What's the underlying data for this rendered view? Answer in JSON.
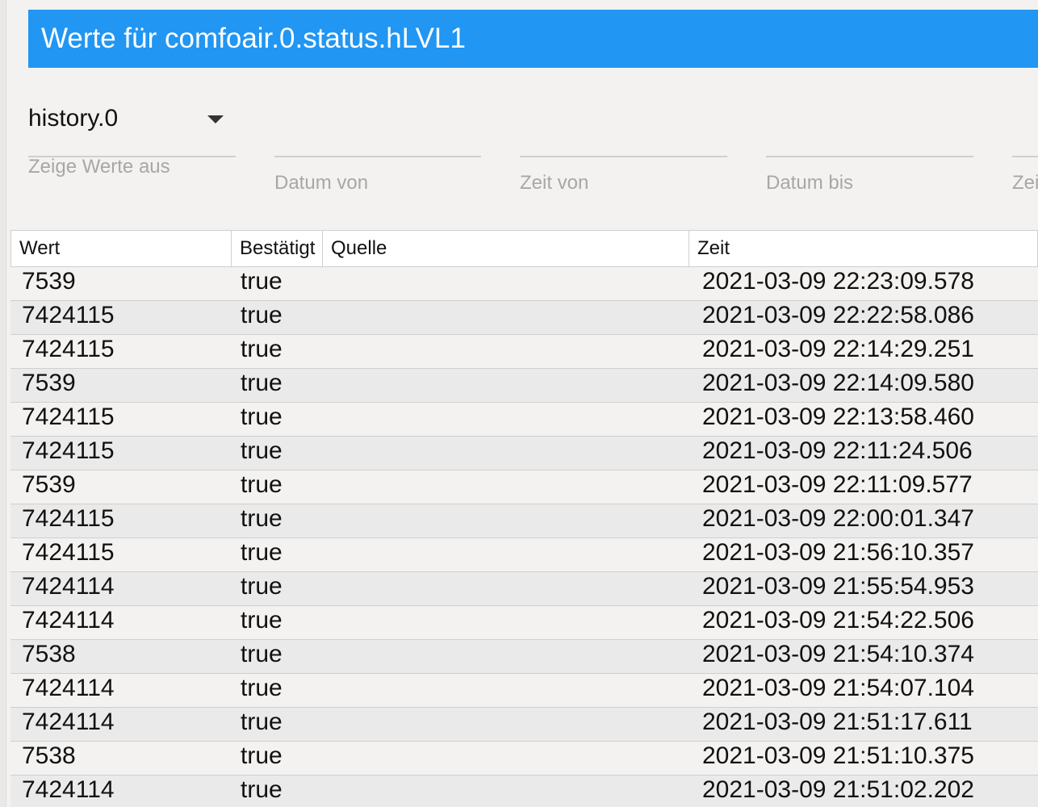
{
  "dialog": {
    "title": "Werte für comfoair.0.status.hLVL1"
  },
  "filters": {
    "instance": {
      "value": "history.0",
      "label": "Zeige Werte aus"
    },
    "date_from_label": "Datum von",
    "time_from_label": "Zeit von",
    "date_to_label": "Datum bis",
    "time_to_label": "Zeit bis"
  },
  "table": {
    "headers": {
      "value": "Wert",
      "ack": "Bestätigt",
      "source": "Quelle",
      "time": "Zeit"
    },
    "rows": [
      {
        "value": "7539",
        "ack": "true",
        "source": "",
        "time": "2021-03-09 22:23:09.578"
      },
      {
        "value": "7424115",
        "ack": "true",
        "source": "",
        "time": "2021-03-09 22:22:58.086"
      },
      {
        "value": "7424115",
        "ack": "true",
        "source": "",
        "time": "2021-03-09 22:14:29.251"
      },
      {
        "value": "7539",
        "ack": "true",
        "source": "",
        "time": "2021-03-09 22:14:09.580"
      },
      {
        "value": "7424115",
        "ack": "true",
        "source": "",
        "time": "2021-03-09 22:13:58.460"
      },
      {
        "value": "7424115",
        "ack": "true",
        "source": "",
        "time": "2021-03-09 22:11:24.506"
      },
      {
        "value": "7539",
        "ack": "true",
        "source": "",
        "time": "2021-03-09 22:11:09.577"
      },
      {
        "value": "7424115",
        "ack": "true",
        "source": "",
        "time": "2021-03-09 22:00:01.347"
      },
      {
        "value": "7424115",
        "ack": "true",
        "source": "",
        "time": "2021-03-09 21:56:10.357"
      },
      {
        "value": "7424114",
        "ack": "true",
        "source": "",
        "time": "2021-03-09 21:55:54.953"
      },
      {
        "value": "7424114",
        "ack": "true",
        "source": "",
        "time": "2021-03-09 21:54:22.506"
      },
      {
        "value": "7538",
        "ack": "true",
        "source": "",
        "time": "2021-03-09 21:54:10.374"
      },
      {
        "value": "7424114",
        "ack": "true",
        "source": "",
        "time": "2021-03-09 21:54:07.104"
      },
      {
        "value": "7424114",
        "ack": "true",
        "source": "",
        "time": "2021-03-09 21:51:17.611"
      },
      {
        "value": "7538",
        "ack": "true",
        "source": "",
        "time": "2021-03-09 21:51:10.375"
      },
      {
        "value": "7424114",
        "ack": "true",
        "source": "",
        "time": "2021-03-09 21:51:02.202"
      }
    ]
  },
  "colors": {
    "header_bg": "#2196f3",
    "header_text": "#ffffff",
    "page_bg": "#f3f2f1",
    "row_alt_bg": "#eaeaea",
    "label_text": "#a7a7a7"
  }
}
